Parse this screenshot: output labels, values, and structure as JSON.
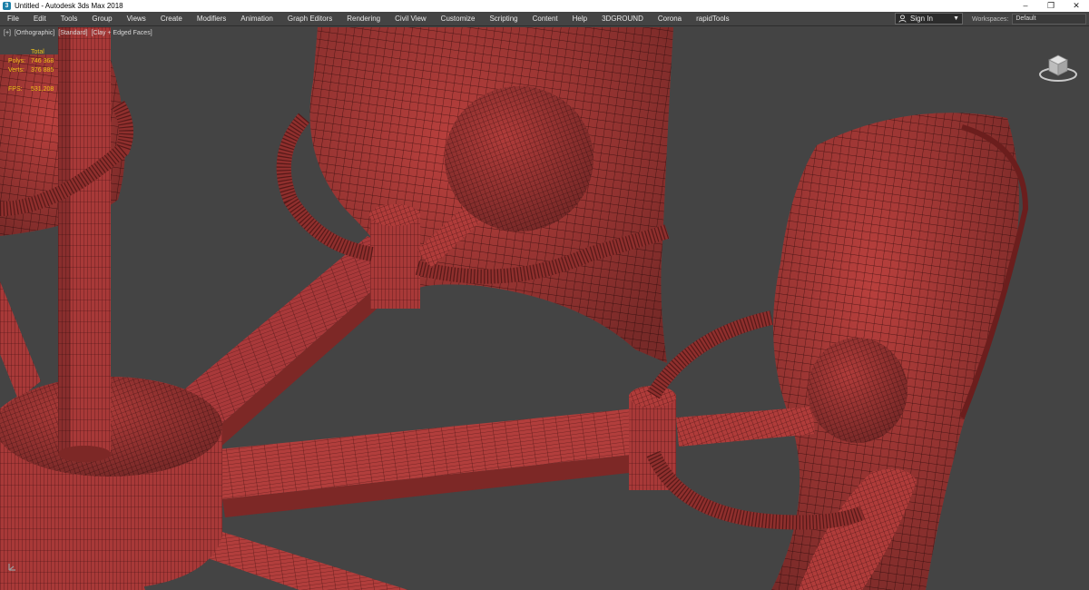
{
  "window": {
    "title": "Untitled - Autodesk 3ds Max 2018",
    "controls": [
      "minimize",
      "restore",
      "close"
    ]
  },
  "menu": {
    "items": [
      "File",
      "Edit",
      "Tools",
      "Group",
      "Views",
      "Create",
      "Modifiers",
      "Animation",
      "Graph Editors",
      "Rendering",
      "Civil View",
      "Customize",
      "Scripting",
      "Content",
      "Help",
      "3DGROUND",
      "Corona",
      "rapidTools"
    ]
  },
  "account": {
    "sign_in_label": "Sign In",
    "workspaces_label": "Workspaces:",
    "workspace_value": "Default"
  },
  "viewport": {
    "label_parts": [
      "[+]",
      "[Orthographic]",
      "[Standard]",
      "[Clay + Edged Faces]"
    ],
    "stats": {
      "header": "Total",
      "polys_label": "Polys:",
      "polys_value": "746 368",
      "verts_label": "Verts:",
      "verts_value": "376 885",
      "fps_label": "FPS:",
      "fps_value": "531,208"
    }
  },
  "colors": {
    "clay": "#b8403e",
    "clay_dark": "#7a2422",
    "wire": "#3a0e0e",
    "viewport_bg": "#444444",
    "stats_text": "#f2c21a"
  }
}
